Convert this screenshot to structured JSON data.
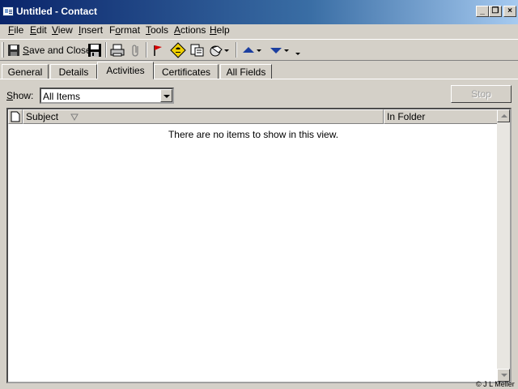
{
  "window": {
    "title": "Untitled - Contact",
    "controls": {
      "minimize": "_",
      "restore": "❐",
      "close": "×"
    }
  },
  "menu": {
    "items": [
      {
        "accel": "F",
        "rest": "ile"
      },
      {
        "accel": "E",
        "rest": "dit"
      },
      {
        "accel": "V",
        "rest": "iew"
      },
      {
        "accel": "I",
        "rest": "nsert"
      },
      {
        "pre": "F",
        "accel": "o",
        "rest": "rmat"
      },
      {
        "accel": "T",
        "rest": "ools"
      },
      {
        "accel": "A",
        "rest": "ctions"
      },
      {
        "accel": "H",
        "rest": "elp"
      }
    ]
  },
  "toolbar": {
    "save_accel": "S",
    "save_rest": "ave and Close",
    "icons": [
      "save-and-close-icon",
      "save-floppy-icon",
      "print-icon",
      "attach-icon",
      "flag-icon",
      "call-icon",
      "new-message-icon",
      "ie-go-icon",
      "previous-item-icon",
      "next-item-icon",
      "toolbar-options-icon"
    ]
  },
  "tabs": [
    "General",
    "Details",
    "Activities",
    "Certificates",
    "All Fields"
  ],
  "active_tab": "Activities",
  "show": {
    "label_accel": "S",
    "label_rest": "how:",
    "selected": "All Items"
  },
  "stop_button": "Stop",
  "list": {
    "columns": [
      "Subject",
      "In Folder"
    ],
    "empty_message": "There are no items to show in this view."
  },
  "copyright": "© J L Meller",
  "colors": {
    "titlebar_start": "#0a246a",
    "titlebar_end": "#a6caf0",
    "face": "#d4d0c8"
  }
}
